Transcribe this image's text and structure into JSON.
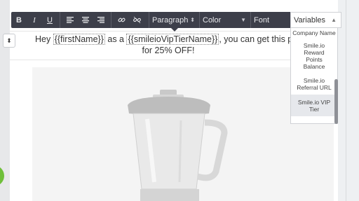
{
  "toolbar": {
    "bold": "B",
    "italic": "I",
    "underline": "U",
    "paragraph": "Paragraph",
    "color": "Color",
    "font": "Font",
    "variables": "Variables"
  },
  "content": {
    "line1_pre": "Hey ",
    "var_first_name": "{{firstName}}",
    "line1_mid": " as a ",
    "var_vip_tier": "{{smileioVipTierName}}",
    "line1_post": ", you can get this product",
    "line2": "for 25%  OFF!"
  },
  "variables_menu": {
    "items": [
      "Company Name",
      "Smile.io Reward Points Balance",
      "Smile.io Referral URL",
      "Smile.io VIP Tier"
    ],
    "selected_index": 3
  },
  "colors": {
    "toolbar_bg": "#3d3f4a",
    "accent_green": "#6fbf3a"
  }
}
